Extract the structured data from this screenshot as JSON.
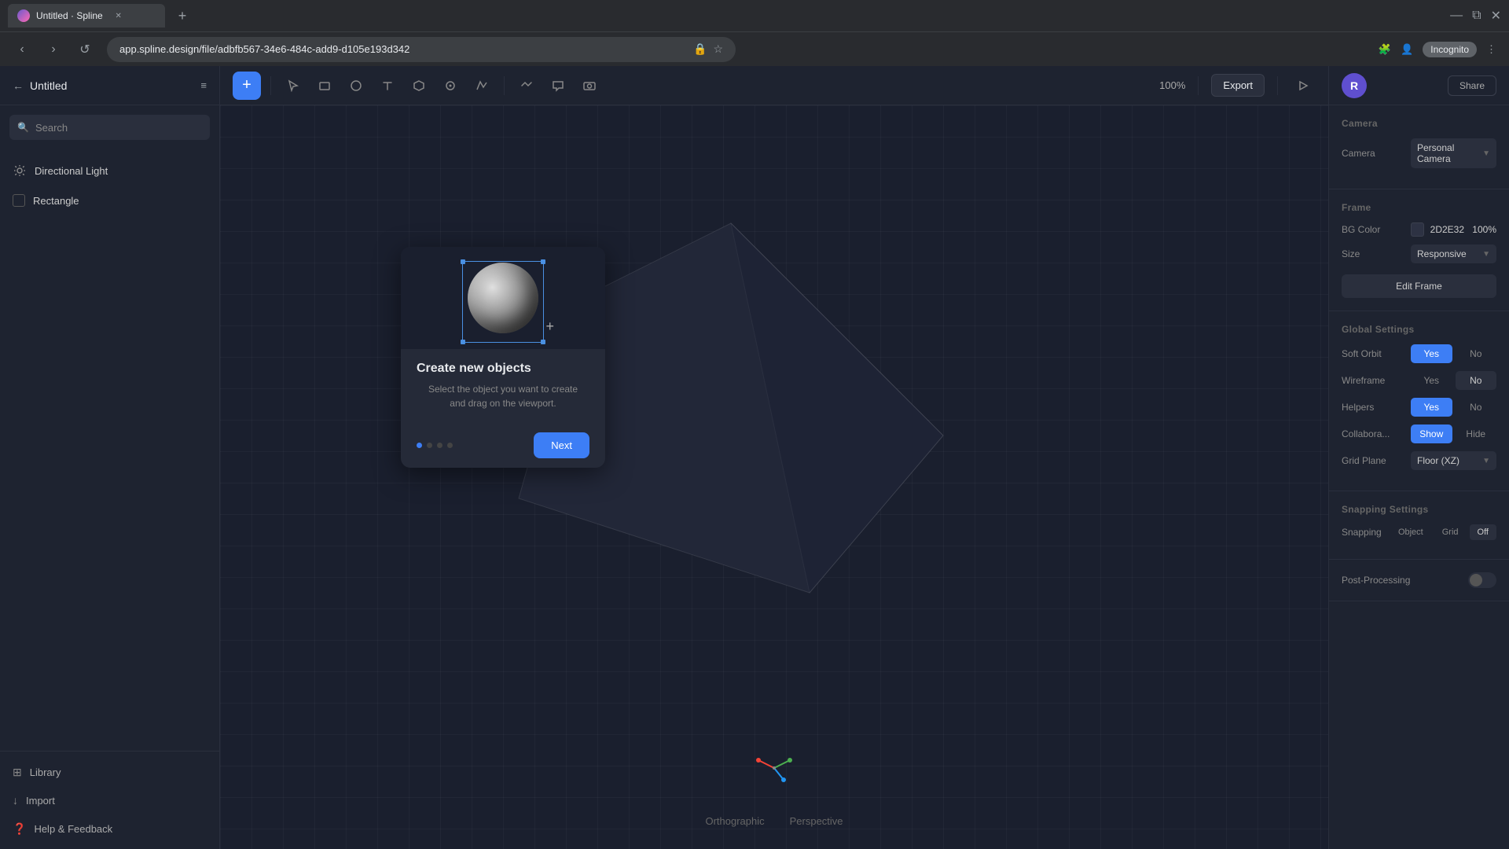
{
  "browser": {
    "tab_title": "Untitled · Spline",
    "url": "app.spline.design/file/adbfb567-34e6-484c-add9-d105e193d342",
    "new_tab_label": "+",
    "incognito_label": "Incognito",
    "nav": {
      "back": "‹",
      "forward": "›",
      "refresh": "↺"
    }
  },
  "app": {
    "title": "Untitled",
    "back_arrow": "←"
  },
  "toolbar": {
    "add_label": "+",
    "zoom": "100%",
    "export_label": "Export"
  },
  "sidebar": {
    "search_placeholder": "Search",
    "items": [
      {
        "label": "Directional Light",
        "type": "light"
      },
      {
        "label": "Rectangle",
        "type": "shape"
      }
    ],
    "bottom": [
      {
        "label": "Library",
        "icon": "⊞"
      },
      {
        "label": "Import",
        "icon": "↓"
      },
      {
        "label": "Help & Feedback",
        "icon": "?"
      }
    ]
  },
  "popup": {
    "title": "Create new objects",
    "description": "Select the object you want to create\nand drag on the viewport.",
    "next_label": "Next",
    "dots": [
      true,
      false,
      false,
      false
    ]
  },
  "right_panel": {
    "avatar_initial": "R",
    "share_label": "Share",
    "camera_section": {
      "title": "Camera",
      "label": "Camera",
      "value": "Personal Camera"
    },
    "frame_section": {
      "title": "Frame",
      "bg_color_label": "BG Color",
      "bg_color_value": "2D2E32",
      "bg_color_opacity": "100%",
      "size_label": "Size",
      "size_value": "Responsive",
      "edit_frame_label": "Edit Frame"
    },
    "global_settings": {
      "title": "Global Settings",
      "soft_orbit_label": "Soft Orbit",
      "yes_label": "Yes",
      "no_label": "No",
      "wireframe_label": "Wireframe",
      "helpers_label": "Helpers",
      "collabora_label": "Collabora...",
      "show_label": "Show",
      "hide_label": "Hide",
      "grid_plane_label": "Grid Plane",
      "grid_plane_value": "Floor (XZ)"
    },
    "snapping": {
      "title": "Snapping Settings",
      "snapping_label": "Snapping",
      "object_label": "Object",
      "grid_label": "Grid",
      "off_label": "Off"
    },
    "post_processing": {
      "label": "Post-Processing"
    }
  },
  "viewport": {
    "orthographic_label": "Orthographic",
    "perspective_label": "Perspective"
  }
}
